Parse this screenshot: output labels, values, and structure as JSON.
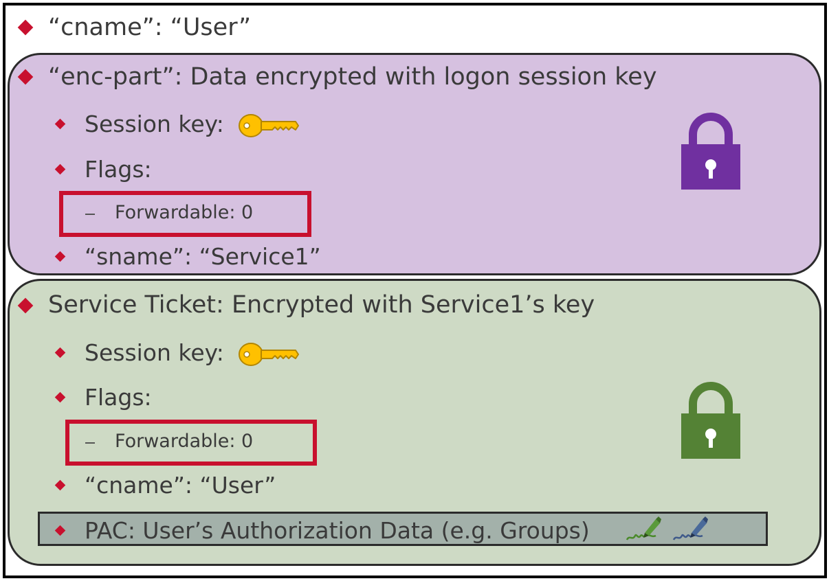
{
  "top_item": "“cname”: “User”",
  "enc_part": {
    "heading": "“enc-part”: Data encrypted with logon session key",
    "session_key_label": "Session key:",
    "flags_label": "Flags:",
    "forwardable": "Forwardable: 0",
    "sname": "“sname”: “Service1”",
    "lock_color": "#7030a0",
    "key_color": "#ffc000"
  },
  "service_ticket": {
    "heading": "Service Ticket: Encrypted with Service1’s key",
    "session_key_label": "Session key:",
    "flags_label": "Flags:",
    "forwardable": "Forwardable: 0",
    "cname": "“cname”: “User”",
    "pac": "PAC: User’s Authorization Data (e.g. Groups)",
    "lock_color": "#548235",
    "key_color": "#ffc000"
  },
  "colors": {
    "bullet": "#c8102e",
    "purple_panel": "#d6c1e0",
    "green_panel": "#cedac5",
    "pac_box": "#a3b1aa",
    "highlight_border": "#c8102e"
  },
  "icons": [
    "key-icon",
    "lock-icon",
    "signature-pen-icon"
  ]
}
